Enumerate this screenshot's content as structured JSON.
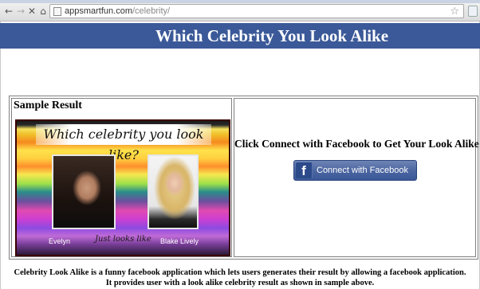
{
  "browser": {
    "url_host": "appsmartfun.com",
    "url_path": "/celebrity/",
    "back_icon": "back-arrow-icon",
    "forward_icon": "forward-arrow-icon",
    "stop_icon": "stop-icon",
    "home_icon": "home-icon",
    "star_icon": "bookmark-star-icon"
  },
  "header": {
    "title": "Which Celebrity You Look Alike",
    "color": "#3b5998"
  },
  "sample": {
    "label": "Sample Result",
    "banner_text": "Which celebrity you look like?",
    "left_name": "Evelyn",
    "middle_text": "Just looks like",
    "right_name": "Blake Lively"
  },
  "connect": {
    "heading": "Click Connect with Facebook to Get Your Look Alike",
    "button_label": "Connect with Facebook",
    "button_logo": "f"
  },
  "footer": {
    "line1": "Celebrity Look Alike is a funny facebook application which lets users generates their result by allowing a facebook application.",
    "line2": "It provides user with a look alike celebrity result as shown in sample above."
  }
}
